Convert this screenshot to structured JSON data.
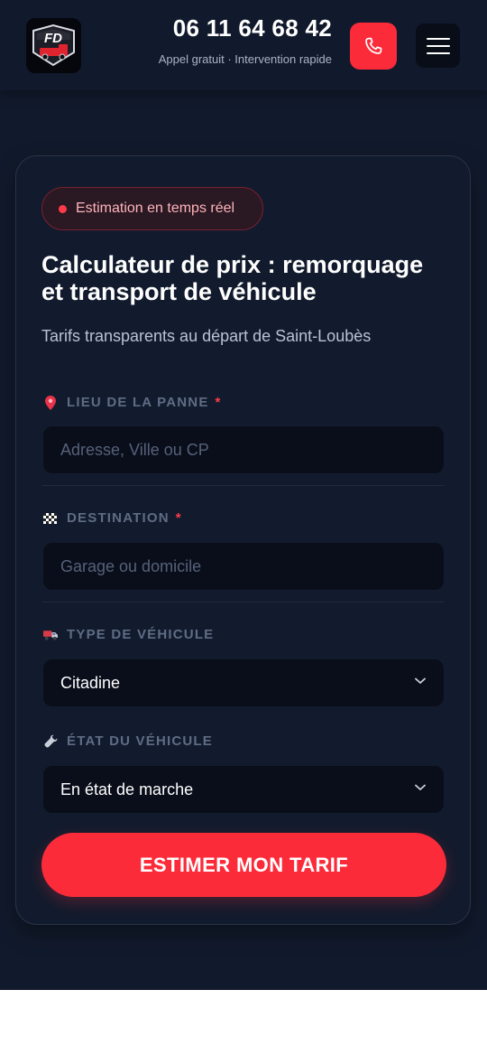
{
  "header": {
    "phone_number": "06 11 64 68 42",
    "phone_subtitle": "Appel gratuit · Intervention rapide",
    "logo_icon": "fd-tow-truck-logo",
    "call_icon": "phone-icon",
    "menu_icon": "hamburger-menu-icon"
  },
  "calculator": {
    "badge": "Estimation en temps réel",
    "title": "Calculateur de prix : remorquage et transport de véhicule",
    "subtitle": "Tarifs transparents au départ de Saint-Loubès",
    "fields": {
      "breakdown_location": {
        "label": "LIEU DE LA PANNE",
        "required": "*",
        "placeholder": "Adresse, Ville ou CP",
        "value": "",
        "icon": "map-pin-icon"
      },
      "destination": {
        "label": "DESTINATION",
        "required": "*",
        "placeholder": "Garage ou domicile",
        "value": "",
        "icon": "checkered-flag-icon"
      },
      "vehicle_type": {
        "label": "TYPE DE VÉHICULE",
        "selected": "Citadine",
        "icon": "truck-icon"
      },
      "vehicle_state": {
        "label": "ÉTAT DU VÉHICULE",
        "selected": "En état de marche",
        "icon": "wrench-icon"
      }
    },
    "submit_label": "ESTIMER MON TARIF"
  },
  "colors": {
    "background": "#111a2c",
    "accent": "#fb2b3a",
    "input_bg": "#090e1a"
  }
}
